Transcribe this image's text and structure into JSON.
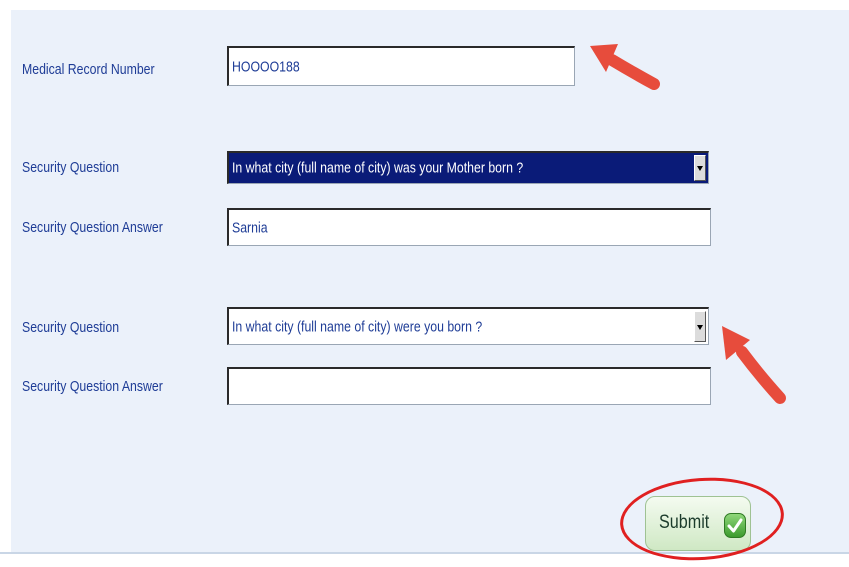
{
  "form": {
    "mrn_label": "Medical Record Number",
    "mrn_value": "HOOOO188",
    "q1_label": "Security Question",
    "q1_selected": "In what city (full name of city) was your Mother born ?",
    "a1_label": "Security Question Answer",
    "a1_value": "Sarnia",
    "q2_label": "Security Question",
    "q2_selected": "In what city (full name of city) were you born ?",
    "a2_label": "Security Question Answer",
    "a2_value": "",
    "submit_label": "Submit"
  },
  "colors": {
    "label_text": "#1e3c96",
    "panel_bg": "#ebf1fa",
    "selected_bg": "#0a1b78",
    "annotation_red": "#e74c3c"
  },
  "icons": {
    "submit": "check-icon",
    "dropdown": "chevron-down-icon"
  }
}
